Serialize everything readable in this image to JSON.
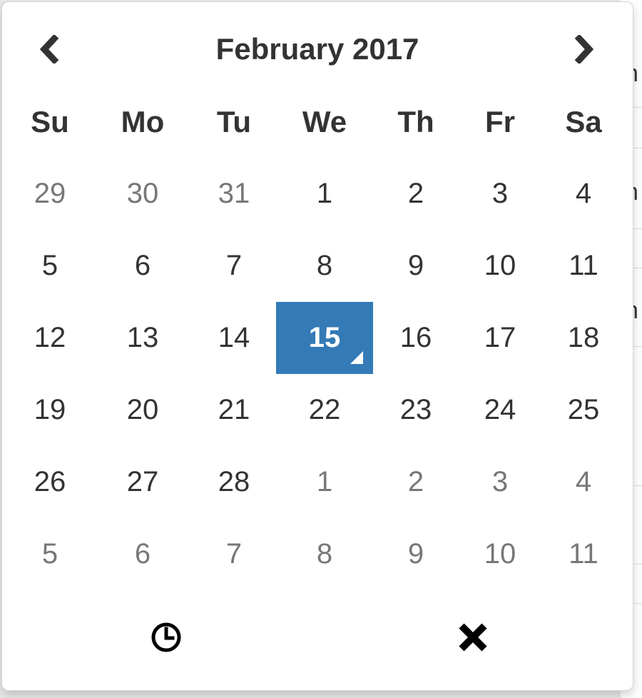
{
  "header": {
    "title": "February 2017",
    "prev_icon": "chevron-left-icon",
    "next_icon": "chevron-right-icon"
  },
  "weekdays": [
    "Su",
    "Mo",
    "Tu",
    "We",
    "Th",
    "Fr",
    "Sa"
  ],
  "weeks": [
    [
      {
        "d": "29",
        "muted": true
      },
      {
        "d": "30",
        "muted": true
      },
      {
        "d": "31",
        "muted": true
      },
      {
        "d": "1"
      },
      {
        "d": "2"
      },
      {
        "d": "3"
      },
      {
        "d": "4"
      }
    ],
    [
      {
        "d": "5"
      },
      {
        "d": "6"
      },
      {
        "d": "7"
      },
      {
        "d": "8"
      },
      {
        "d": "9"
      },
      {
        "d": "10"
      },
      {
        "d": "11"
      }
    ],
    [
      {
        "d": "12"
      },
      {
        "d": "13"
      },
      {
        "d": "14"
      },
      {
        "d": "15",
        "active": true,
        "today": true
      },
      {
        "d": "16"
      },
      {
        "d": "17"
      },
      {
        "d": "18"
      }
    ],
    [
      {
        "d": "19"
      },
      {
        "d": "20"
      },
      {
        "d": "21"
      },
      {
        "d": "22"
      },
      {
        "d": "23"
      },
      {
        "d": "24"
      },
      {
        "d": "25"
      }
    ],
    [
      {
        "d": "26"
      },
      {
        "d": "27"
      },
      {
        "d": "28"
      },
      {
        "d": "1",
        "muted": true
      },
      {
        "d": "2",
        "muted": true
      },
      {
        "d": "3",
        "muted": true
      },
      {
        "d": "4",
        "muted": true
      }
    ],
    [
      {
        "d": "5",
        "muted": true
      },
      {
        "d": "6",
        "muted": true
      },
      {
        "d": "7",
        "muted": true
      },
      {
        "d": "8",
        "muted": true
      },
      {
        "d": "9",
        "muted": true
      },
      {
        "d": "10",
        "muted": true
      },
      {
        "d": "11",
        "muted": true
      }
    ]
  ],
  "footer": {
    "time_icon": "clock-icon",
    "close_icon": "close-icon"
  },
  "colors": {
    "accent": "#337ab7",
    "text": "#333333",
    "muted": "#777777"
  },
  "background_glyphs": [
    "n",
    "n",
    "n"
  ]
}
